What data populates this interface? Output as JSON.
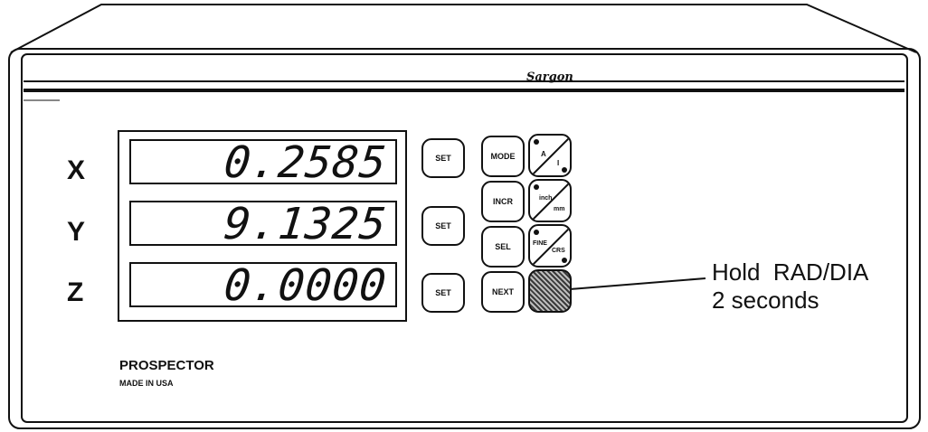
{
  "axes": [
    {
      "label": "X",
      "reading": "0.2585"
    },
    {
      "label": "Y",
      "reading": "9.1325"
    },
    {
      "label": "Z",
      "reading": "0.0000"
    }
  ],
  "keys": {
    "set": "SET",
    "mode": "MODE",
    "incr": "INCR",
    "sel": "SEL",
    "next": "NEXT"
  },
  "toggles": {
    "abs_incr": {
      "upper": "A",
      "lower": "I"
    },
    "units": {
      "upper": "inch",
      "lower": "mm"
    },
    "resolution": {
      "upper": "FINE",
      "lower": "CRS"
    }
  },
  "rad_dia_key": {
    "icon": "hatched-square"
  },
  "logo": "Sargon",
  "brand": "PROSPECTOR",
  "made_in": "MADE IN USA",
  "callout": {
    "line1": "Hold  RAD/DIA",
    "line2": "2 seconds"
  }
}
